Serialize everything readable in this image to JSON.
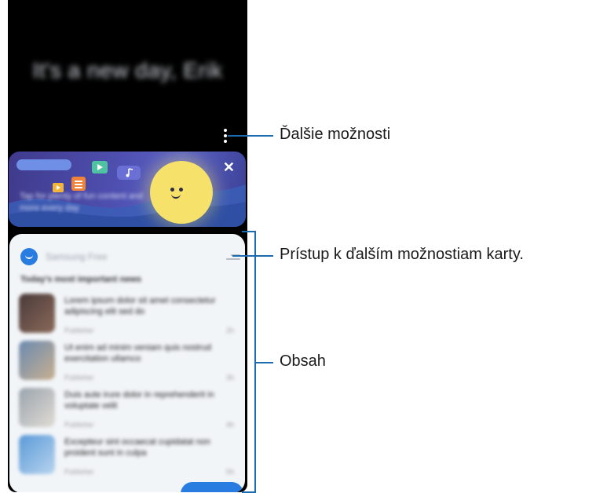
{
  "screen": {
    "greeting": "It's a new day, Erik",
    "banner": {
      "text": "Tap for plenty of fun content and more every day",
      "close_icon": "close-icon"
    },
    "card": {
      "title": "Samsung Free",
      "subtitle": "Today's most important news",
      "news": [
        {
          "headline": "Lorem ipsum dolor sit amet consectetur adipiscing elit sed do",
          "meta": "Publisher",
          "time": "2h"
        },
        {
          "headline": "Ut enim ad minim veniam quis nostrud exercitation ullamco",
          "meta": "Publisher",
          "time": "3h"
        },
        {
          "headline": "Duis aute irure dolor in reprehenderit in voluptate velit",
          "meta": "Publisher",
          "time": "4h"
        },
        {
          "headline": "Excepteur sint occaecat cupidatat non proident sunt in culpa",
          "meta": "Publisher",
          "time": "5h"
        }
      ]
    }
  },
  "callouts": {
    "more_options": "Ďalšie možnosti",
    "card_options": "Prístup k ďalším možnostiam karty.",
    "content": "Obsah"
  },
  "colors": {
    "callout_line": "#1a6bb0",
    "accent": "#2a7de0",
    "sun": "#f6e26b"
  }
}
